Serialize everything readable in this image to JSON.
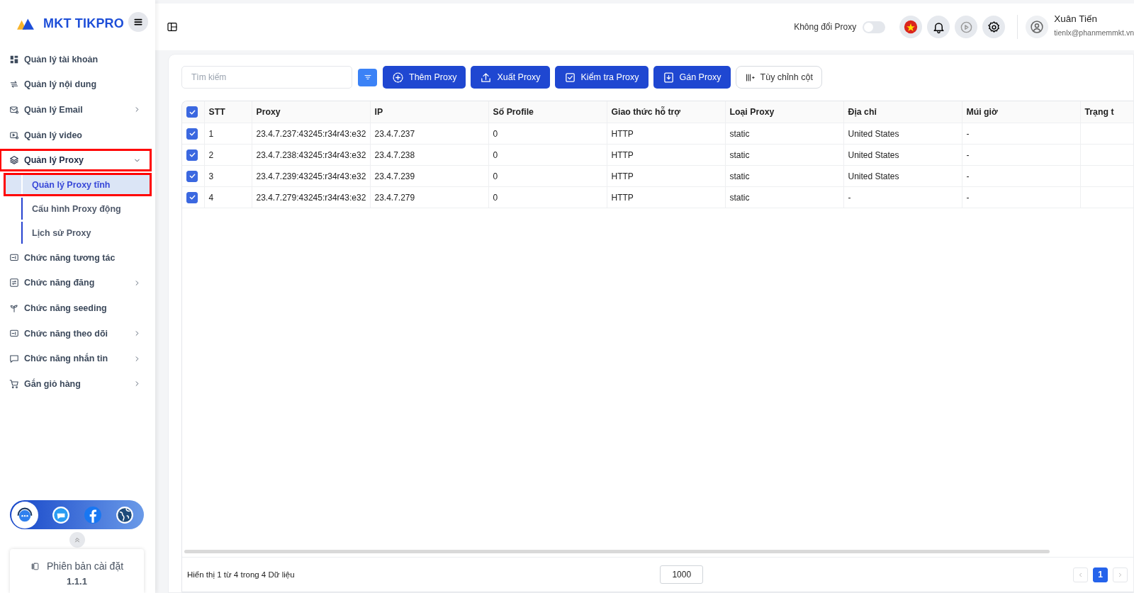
{
  "logo": {
    "text": "MKT TIKPRO"
  },
  "sidebar": {
    "items": [
      {
        "label": "Quản lý tài khoản",
        "expandable": false,
        "expanded": false,
        "highlighted": false
      },
      {
        "label": "Quản lý nội dung",
        "expandable": false,
        "expanded": false,
        "highlighted": false
      },
      {
        "label": "Quản lý Email",
        "expandable": true,
        "expanded": false,
        "highlighted": false
      },
      {
        "label": "Quản lý video",
        "expandable": false,
        "expanded": false,
        "highlighted": false
      },
      {
        "label": "Quản lý Proxy",
        "expandable": true,
        "expanded": true,
        "highlighted": true,
        "children": [
          {
            "label": "Quản lý Proxy tĩnh",
            "selected": true,
            "highlighted": true
          },
          {
            "label": "Cấu hình Proxy động",
            "selected": false,
            "highlighted": false
          },
          {
            "label": "Lịch sử Proxy",
            "selected": false,
            "highlighted": false
          }
        ]
      },
      {
        "label": "Chức năng tương tác",
        "expandable": false,
        "expanded": false,
        "highlighted": false
      },
      {
        "label": "Chức năng đăng",
        "expandable": true,
        "expanded": false,
        "highlighted": false
      },
      {
        "label": "Chức năng seeding",
        "expandable": false,
        "expanded": false,
        "highlighted": false
      },
      {
        "label": "Chức năng theo dõi",
        "expandable": true,
        "expanded": false,
        "highlighted": false
      },
      {
        "label": "Chức năng nhắn tin",
        "expandable": true,
        "expanded": false,
        "highlighted": false
      },
      {
        "label": "Gắn giỏ hàng",
        "expandable": true,
        "expanded": false,
        "highlighted": false
      }
    ],
    "version": {
      "label": "Phiên bản cài đặt",
      "value": "1.1.1"
    }
  },
  "header": {
    "proxy_toggle": {
      "label": "Không đổi Proxy",
      "on": false
    },
    "user": {
      "name": "Xuân Tiến",
      "email": "tienlx@phanmemmkt.vn"
    }
  },
  "toolbar": {
    "search": {
      "placeholder": "Tìm kiếm"
    },
    "buttons": [
      {
        "label": "Thêm Proxy",
        "kind": "primary"
      },
      {
        "label": "Xuất Proxy",
        "kind": "primary"
      },
      {
        "label": "Kiểm tra Proxy",
        "kind": "primary"
      },
      {
        "label": "Gán Proxy",
        "kind": "primary"
      },
      {
        "label": "Tùy chỉnh cột",
        "kind": "outline"
      }
    ]
  },
  "table": {
    "all_checked": true,
    "columns": [
      "STT",
      "Proxy",
      "IP",
      "Số Profile",
      "Giao thức hỗ trợ",
      "Loại Proxy",
      "Địa chỉ",
      "Múi giờ",
      "Trạng t"
    ],
    "rows": [
      {
        "checked": true,
        "cells": [
          "1",
          "23.4.7.237:43245:r34r43:e32",
          "23.4.7.237",
          "0",
          "HTTP",
          "static",
          "United States",
          "-",
          ""
        ]
      },
      {
        "checked": true,
        "cells": [
          "2",
          "23.4.7.238:43245:r34r43:e32",
          "23.4.7.238",
          "0",
          "HTTP",
          "static",
          "United States",
          "-",
          ""
        ]
      },
      {
        "checked": true,
        "cells": [
          "3",
          "23.4.7.239:43245:r34r43:e32",
          "23.4.7.239",
          "0",
          "HTTP",
          "static",
          "United States",
          "-",
          ""
        ]
      },
      {
        "checked": true,
        "cells": [
          "4",
          "23.4.7.279:43245:r34r43:e32",
          "23.4.7.279",
          "0",
          "HTTP",
          "static",
          "-",
          "-",
          ""
        ]
      }
    ]
  },
  "footer": {
    "summary": "Hiển thị 1 từ 4 trong 4 Dữ liệu",
    "page_size": "1000",
    "pages": [
      {
        "label": "1",
        "selected": true
      }
    ]
  }
}
